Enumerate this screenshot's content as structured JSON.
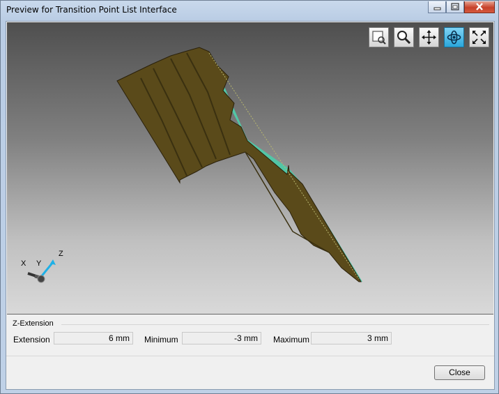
{
  "window": {
    "title": "Preview for Transition Point List Interface",
    "controls": [
      "minimize-icon",
      "maximize-icon",
      "close-icon"
    ]
  },
  "viewport": {
    "toolbar": [
      {
        "name": "zoom-window-icon",
        "active": false
      },
      {
        "name": "zoom-icon",
        "active": false
      },
      {
        "name": "pan-icon",
        "active": false
      },
      {
        "name": "rotate-icon",
        "active": true
      },
      {
        "name": "fit-all-icon",
        "active": false
      }
    ],
    "triad": {
      "x": "X",
      "y": "Y",
      "z": "Z"
    },
    "colors": {
      "surface": "#5a4a1a",
      "flank": "#52c6a6",
      "accent": "#1fb0e6"
    }
  },
  "z_extension": {
    "group_title": "Z-Extension",
    "extension_label": "Extension",
    "extension_value": "6 mm",
    "minimum_label": "Minimum",
    "minimum_value": "-3 mm",
    "maximum_label": "Maximum",
    "maximum_value": "3 mm"
  },
  "close_label": "Close"
}
